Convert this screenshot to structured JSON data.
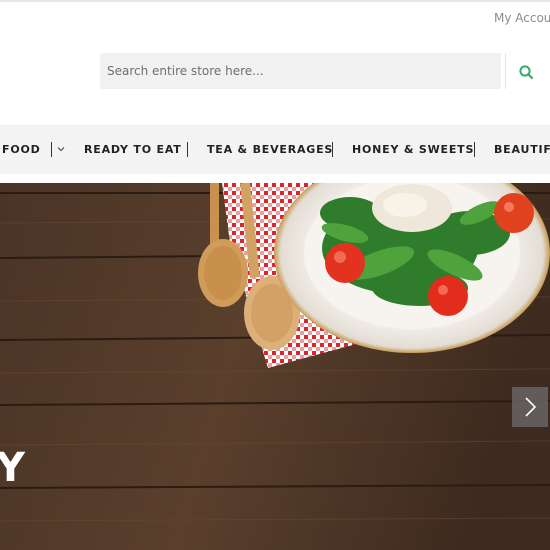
{
  "header": {
    "account_link": "My Accou"
  },
  "search": {
    "placeholder": "Search entire store here...",
    "icon": "search-icon",
    "icon_color": "#3aaa6e"
  },
  "nav": {
    "items": [
      {
        "label": "FOOD"
      },
      {
        "label": "READY TO EAT"
      },
      {
        "label": "TEA & BEVERAGES"
      },
      {
        "label": "HONEY & SWEETS"
      },
      {
        "label": "BEAUTIFU"
      }
    ],
    "dropdown_icon": "chevron-down-icon"
  },
  "hero": {
    "partial_heading": "Y",
    "image": "salad-plate-with-wooden-spoons-on-wood-table",
    "next_icon": "chevron-right-icon"
  }
}
